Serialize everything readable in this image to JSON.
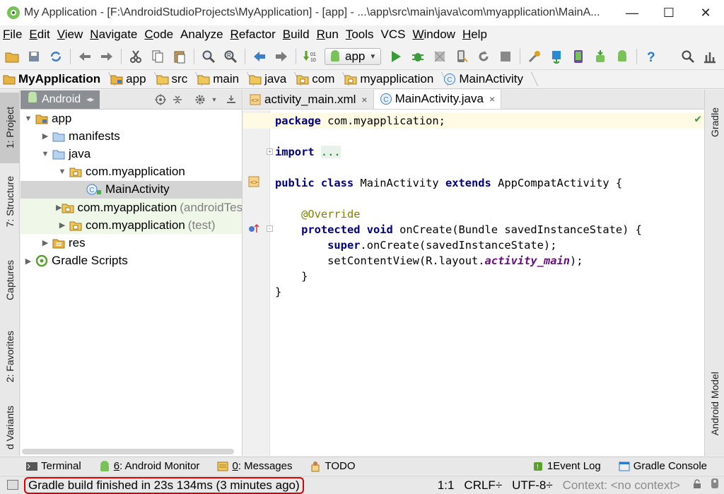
{
  "window": {
    "title": "My Application - [F:\\AndroidStudioProjects\\MyApplication] - [app] - ...\\app\\src\\main\\java\\com\\myapplication\\MainA...",
    "controls": {
      "minimize": "—",
      "maximize": "☐",
      "close": "✕"
    }
  },
  "menu": {
    "items": [
      {
        "m": "F",
        "rest": "ile"
      },
      {
        "m": "E",
        "rest": "dit"
      },
      {
        "m": "V",
        "rest": "iew"
      },
      {
        "m": "N",
        "rest": "avigate"
      },
      {
        "m": "C",
        "rest": "ode"
      },
      {
        "m": "",
        "rest": "Analyze"
      },
      {
        "m": "R",
        "rest": "efactor"
      },
      {
        "m": "B",
        "rest": "uild"
      },
      {
        "m": "R",
        "rest": "un"
      },
      {
        "m": "T",
        "rest": "ools"
      },
      {
        "m": "",
        "rest": "VCS"
      },
      {
        "m": "W",
        "rest": "indow"
      },
      {
        "m": "H",
        "rest": "elp"
      }
    ]
  },
  "toolbar": {
    "run_config": "app"
  },
  "breadcrumb": [
    "MyApplication",
    "app",
    "src",
    "main",
    "java",
    "com",
    "myapplication",
    "MainActivity"
  ],
  "left_tabs": [
    "1: Project",
    "7: Structure",
    "Captures",
    "2: Favorites",
    "d Variants"
  ],
  "right_tabs": [
    "Gradle",
    "Android Model"
  ],
  "project": {
    "view_mode": "Android",
    "tree": [
      {
        "label": "app",
        "suffix": "",
        "indent": 0,
        "arrow": "▼",
        "icon": "module"
      },
      {
        "label": "manifests",
        "suffix": "",
        "indent": 1,
        "arrow": "▶",
        "icon": "folder"
      },
      {
        "label": "java",
        "suffix": "",
        "indent": 1,
        "arrow": "▼",
        "icon": "folder"
      },
      {
        "label": "com.myapplication",
        "suffix": "",
        "indent": 2,
        "arrow": "▼",
        "icon": "package"
      },
      {
        "label": "MainActivity",
        "suffix": "",
        "indent": 3,
        "arrow": "",
        "icon": "class",
        "selected": true
      },
      {
        "label": "com.myapplication",
        "suffix": "(androidTest)",
        "indent": 2,
        "arrow": "▶",
        "icon": "package",
        "test": true
      },
      {
        "label": "com.myapplication",
        "suffix": "(test)",
        "indent": 2,
        "arrow": "▶",
        "icon": "package",
        "test": true
      },
      {
        "label": "res",
        "suffix": "",
        "indent": 1,
        "arrow": "▶",
        "icon": "res"
      },
      {
        "label": "Gradle Scripts",
        "suffix": "",
        "indent": 0,
        "arrow": "▶",
        "icon": "gradle"
      }
    ]
  },
  "editor": {
    "tabs": [
      {
        "label": "activity_main.xml",
        "active": false,
        "icon": "xml"
      },
      {
        "label": "MainActivity.java",
        "active": true,
        "icon": "class"
      }
    ],
    "code": {
      "l1_kw": "package",
      "l1_rest": " com.myapplication;",
      "l2_kw": "import",
      "l2_fold": "...",
      "l3_kw1": "public class",
      "l3_mid": " MainActivity ",
      "l3_kw2": "extends",
      "l3_rest": " AppCompatActivity {",
      "l4_ann": "@Override",
      "l5_kw": "protected void",
      "l5_rest": " onCreate(Bundle savedInstanceState) {",
      "l6_kw": "super",
      "l6_rest": ".onCreate(savedInstanceState);",
      "l7_pre": "setContentView(R.layout.",
      "l7_it": "activity_main",
      "l7_post": ");",
      "l8": "}",
      "l9": "}"
    }
  },
  "tool_tabs": [
    {
      "label": "Terminal",
      "num": "",
      "icon": "terminal"
    },
    {
      "label": ": Android Monitor",
      "num": "6",
      "icon": "android"
    },
    {
      "label": ": Messages",
      "num": "0",
      "icon": "messages"
    },
    {
      "label": "TODO",
      "num": "",
      "icon": "todo"
    }
  ],
  "tool_tabs_right": [
    {
      "label": "Event Log",
      "num": "1 ",
      "icon": "eventlog"
    },
    {
      "label": "Gradle Console",
      "num": "",
      "icon": "console"
    }
  ],
  "status": {
    "message": "Gradle build finished in 23s 134ms (3 minutes ago)",
    "position": "1:1",
    "line_sep": "CRLF÷",
    "encoding": "UTF-8÷",
    "context": "Context: <no context>"
  },
  "colors": {
    "keyword": "#000080",
    "annotation": "#808000",
    "android_green": "#78c257",
    "status_highlight": "#e00000"
  }
}
